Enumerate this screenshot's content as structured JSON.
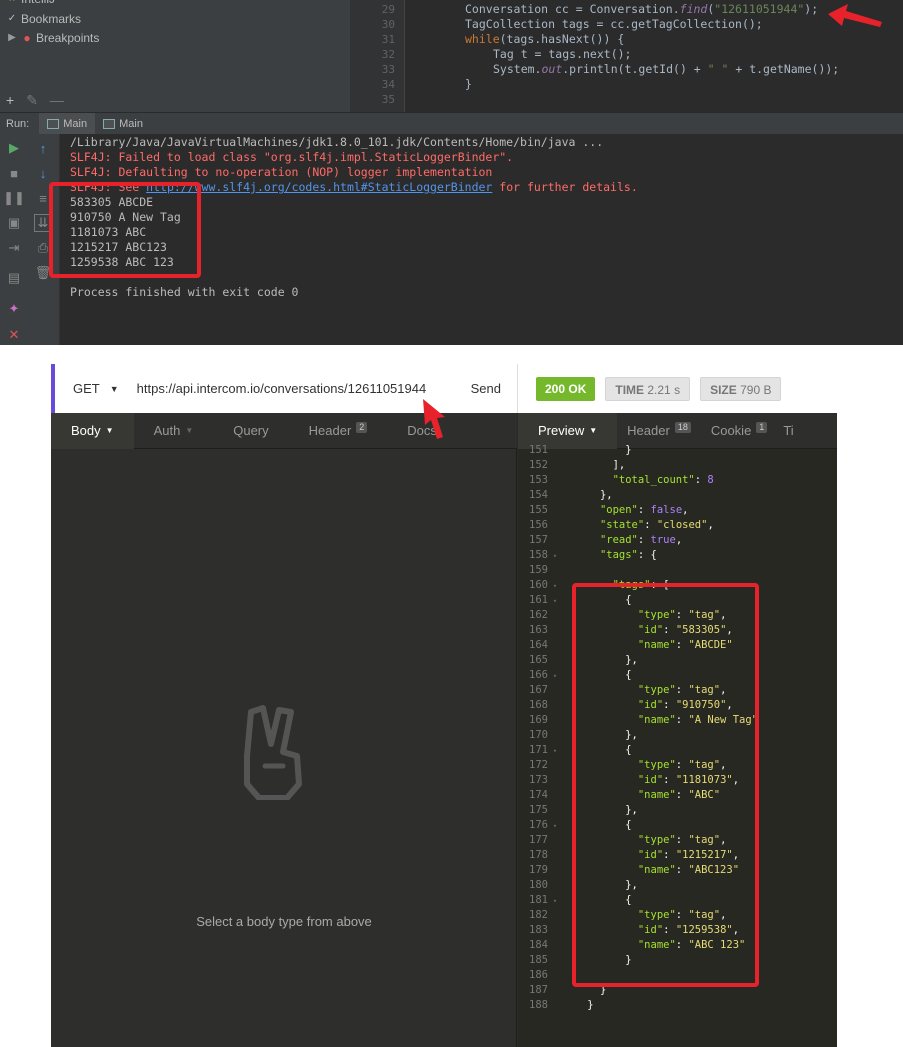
{
  "ide": {
    "tree_top_label": "IntelliJ",
    "tree_items": [
      {
        "label": "Bookmarks",
        "icon": "check-icon"
      },
      {
        "label": "Breakpoints",
        "icon": "breakpoint-dot-icon"
      }
    ],
    "gutter_lines": [
      "29",
      "30",
      "31",
      "32",
      "33",
      "34",
      "35"
    ],
    "code": {
      "line1_a": "Conversation cc = Conversation.",
      "line1_fn": "find",
      "line1_b": "(",
      "line1_str": "\"12611051944\"",
      "line1_c": ");",
      "line2": "TagCollection tags = cc.getTagCollection();",
      "line3_kw": "while",
      "line3_rest": "(tags.hasNext()) {",
      "line4": "Tag t = tags.next();",
      "line5_a": "System.",
      "line5_out": "out",
      "line5_b": ".println(t.getId() + ",
      "line5_str": "\" \"",
      "line5_c": " + t.getName());",
      "line6": "}"
    },
    "run_label": "Run:",
    "run_tabs": [
      "Main",
      "Main"
    ],
    "console": {
      "java_path": "/Library/Java/JavaVirtualMachines/jdk1.8.0_101.jdk/Contents/Home/bin/java ...",
      "slf4j_1": "SLF4J: Failed to load class \"org.slf4j.impl.StaticLoggerBinder\".",
      "slf4j_2": "SLF4J: Defaulting to no-operation (NOP) logger implementation",
      "slf4j_3_prefix": "SLF4J: See ",
      "slf4j_3_link": "http://www.slf4j.org/codes.html#StaticLoggerBinder",
      "slf4j_3_suffix": " for further details.",
      "output": [
        "583305 ABCDE",
        "910750 A New Tag",
        "1181073 ABC",
        "1215217 ABC123",
        "1259538 ABC 123"
      ],
      "exit": "Process finished with exit code 0"
    }
  },
  "request": {
    "method": "GET",
    "url": "https://api.intercom.io/conversations/12611051944",
    "send_label": "Send",
    "tabs": [
      {
        "label": "Body",
        "badge": ""
      },
      {
        "label": "Auth",
        "badge": ""
      },
      {
        "label": "Query",
        "badge": ""
      },
      {
        "label": "Header",
        "badge": "2"
      },
      {
        "label": "Docs",
        "badge": ""
      }
    ],
    "empty_message": "Select a body type from above"
  },
  "response": {
    "status": "200 OK",
    "time_label": "TIME",
    "time_value": "2.21 s",
    "size_label": "SIZE",
    "size_value": "790 B",
    "tabs": [
      {
        "label": "Preview",
        "badge": ""
      },
      {
        "label": "Header",
        "badge": "18"
      },
      {
        "label": "Cookie",
        "badge": "1"
      },
      {
        "label": "Ti",
        "badge": ""
      }
    ],
    "json_lines": [
      {
        "n": "151",
        "f": "",
        "i": 5,
        "t": [
          [
            "p",
            "}"
          ]
        ]
      },
      {
        "n": "152",
        "f": "",
        "i": 4,
        "t": [
          [
            "p",
            "],"
          ]
        ]
      },
      {
        "n": "153",
        "f": "",
        "i": 4,
        "t": [
          [
            "k",
            "\"total_count\""
          ],
          [
            "p",
            ": "
          ],
          [
            "n",
            "8"
          ]
        ]
      },
      {
        "n": "154",
        "f": "",
        "i": 3,
        "t": [
          [
            "p",
            "},"
          ]
        ]
      },
      {
        "n": "155",
        "f": "",
        "i": 3,
        "t": [
          [
            "k",
            "\"open\""
          ],
          [
            "p",
            ": "
          ],
          [
            "n",
            "false"
          ],
          [
            "p",
            ","
          ]
        ]
      },
      {
        "n": "156",
        "f": "",
        "i": 3,
        "t": [
          [
            "k",
            "\"state\""
          ],
          [
            "p",
            ": "
          ],
          [
            "s",
            "\"closed\""
          ],
          [
            "p",
            ","
          ]
        ]
      },
      {
        "n": "157",
        "f": "",
        "i": 3,
        "t": [
          [
            "k",
            "\"read\""
          ],
          [
            "p",
            ": "
          ],
          [
            "n",
            "true"
          ],
          [
            "p",
            ","
          ]
        ]
      },
      {
        "n": "158",
        "f": "▾",
        "i": 3,
        "t": [
          [
            "k",
            "\"tags\""
          ],
          [
            "p",
            ": {"
          ]
        ]
      },
      {
        "n": "159",
        "f": "",
        "i": 4,
        "t": [
          [
            "p",
            ""
          ]
        ]
      },
      {
        "n": "160",
        "f": "▾",
        "i": 4,
        "t": [
          [
            "k",
            "\"tags\""
          ],
          [
            "p",
            ": ["
          ]
        ]
      },
      {
        "n": "161",
        "f": "▾",
        "i": 5,
        "t": [
          [
            "p",
            "{"
          ]
        ]
      },
      {
        "n": "162",
        "f": "",
        "i": 6,
        "t": [
          [
            "k",
            "\"type\""
          ],
          [
            "p",
            ": "
          ],
          [
            "s",
            "\"tag\""
          ],
          [
            "p",
            ","
          ]
        ]
      },
      {
        "n": "163",
        "f": "",
        "i": 6,
        "t": [
          [
            "k",
            "\"id\""
          ],
          [
            "p",
            ": "
          ],
          [
            "s",
            "\"583305\""
          ],
          [
            "p",
            ","
          ]
        ]
      },
      {
        "n": "164",
        "f": "",
        "i": 6,
        "t": [
          [
            "k",
            "\"name\""
          ],
          [
            "p",
            ": "
          ],
          [
            "s",
            "\"ABCDE\""
          ]
        ]
      },
      {
        "n": "165",
        "f": "",
        "i": 5,
        "t": [
          [
            "p",
            "},"
          ]
        ]
      },
      {
        "n": "166",
        "f": "▾",
        "i": 5,
        "t": [
          [
            "p",
            "{"
          ]
        ]
      },
      {
        "n": "167",
        "f": "",
        "i": 6,
        "t": [
          [
            "k",
            "\"type\""
          ],
          [
            "p",
            ": "
          ],
          [
            "s",
            "\"tag\""
          ],
          [
            "p",
            ","
          ]
        ]
      },
      {
        "n": "168",
        "f": "",
        "i": 6,
        "t": [
          [
            "k",
            "\"id\""
          ],
          [
            "p",
            ": "
          ],
          [
            "s",
            "\"910750\""
          ],
          [
            "p",
            ","
          ]
        ]
      },
      {
        "n": "169",
        "f": "",
        "i": 6,
        "t": [
          [
            "k",
            "\"name\""
          ],
          [
            "p",
            ": "
          ],
          [
            "s",
            "\"A New Tag\""
          ]
        ]
      },
      {
        "n": "170",
        "f": "",
        "i": 5,
        "t": [
          [
            "p",
            "},"
          ]
        ]
      },
      {
        "n": "171",
        "f": "▾",
        "i": 5,
        "t": [
          [
            "p",
            "{"
          ]
        ]
      },
      {
        "n": "172",
        "f": "",
        "i": 6,
        "t": [
          [
            "k",
            "\"type\""
          ],
          [
            "p",
            ": "
          ],
          [
            "s",
            "\"tag\""
          ],
          [
            "p",
            ","
          ]
        ]
      },
      {
        "n": "173",
        "f": "",
        "i": 6,
        "t": [
          [
            "k",
            "\"id\""
          ],
          [
            "p",
            ": "
          ],
          [
            "s",
            "\"1181073\""
          ],
          [
            "p",
            ","
          ]
        ]
      },
      {
        "n": "174",
        "f": "",
        "i": 6,
        "t": [
          [
            "k",
            "\"name\""
          ],
          [
            "p",
            ": "
          ],
          [
            "s",
            "\"ABC\""
          ]
        ]
      },
      {
        "n": "175",
        "f": "",
        "i": 5,
        "t": [
          [
            "p",
            "},"
          ]
        ]
      },
      {
        "n": "176",
        "f": "▾",
        "i": 5,
        "t": [
          [
            "p",
            "{"
          ]
        ]
      },
      {
        "n": "177",
        "f": "",
        "i": 6,
        "t": [
          [
            "k",
            "\"type\""
          ],
          [
            "p",
            ": "
          ],
          [
            "s",
            "\"tag\""
          ],
          [
            "p",
            ","
          ]
        ]
      },
      {
        "n": "178",
        "f": "",
        "i": 6,
        "t": [
          [
            "k",
            "\"id\""
          ],
          [
            "p",
            ": "
          ],
          [
            "s",
            "\"1215217\""
          ],
          [
            "p",
            ","
          ]
        ]
      },
      {
        "n": "179",
        "f": "",
        "i": 6,
        "t": [
          [
            "k",
            "\"name\""
          ],
          [
            "p",
            ": "
          ],
          [
            "s",
            "\"ABC123\""
          ]
        ]
      },
      {
        "n": "180",
        "f": "",
        "i": 5,
        "t": [
          [
            "p",
            "},"
          ]
        ]
      },
      {
        "n": "181",
        "f": "▾",
        "i": 5,
        "t": [
          [
            "p",
            "{"
          ]
        ]
      },
      {
        "n": "182",
        "f": "",
        "i": 6,
        "t": [
          [
            "k",
            "\"type\""
          ],
          [
            "p",
            ": "
          ],
          [
            "s",
            "\"tag\""
          ],
          [
            "p",
            ","
          ]
        ]
      },
      {
        "n": "183",
        "f": "",
        "i": 6,
        "t": [
          [
            "k",
            "\"id\""
          ],
          [
            "p",
            ": "
          ],
          [
            "s",
            "\"1259538\""
          ],
          [
            "p",
            ","
          ]
        ]
      },
      {
        "n": "184",
        "f": "",
        "i": 6,
        "t": [
          [
            "k",
            "\"name\""
          ],
          [
            "p",
            ": "
          ],
          [
            "s",
            "\"ABC 123\""
          ]
        ]
      },
      {
        "n": "185",
        "f": "",
        "i": 5,
        "t": [
          [
            "p",
            "}"
          ]
        ]
      },
      {
        "n": "186",
        "f": "",
        "i": 4,
        "t": [
          [
            "p",
            ""
          ]
        ]
      },
      {
        "n": "187",
        "f": "",
        "i": 3,
        "t": [
          [
            "p",
            "}"
          ]
        ]
      },
      {
        "n": "188",
        "f": "",
        "i": 2,
        "t": [
          [
            "p",
            "}"
          ]
        ]
      }
    ]
  },
  "colors": {
    "highlight_red": "#e8222a",
    "status_green": "#75b82c",
    "request_accent": "#6a4bd8"
  }
}
